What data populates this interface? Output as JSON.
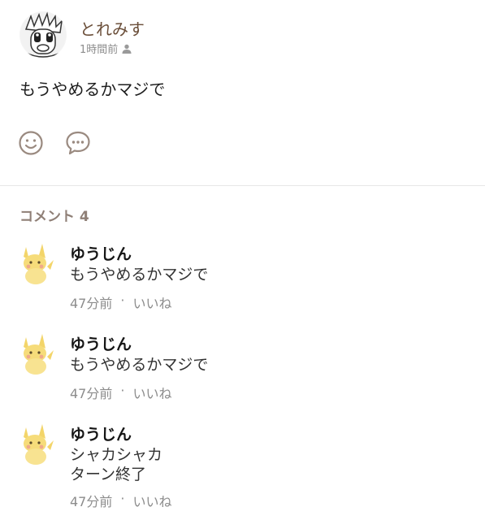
{
  "post": {
    "author": "とれみす",
    "time": "1時間前",
    "body": "もうやめるかマジで"
  },
  "icons": {
    "visibility": "person-icon",
    "reaction": "smiley-icon",
    "comment": "speech-bubble-icon"
  },
  "colors": {
    "author": "#6b4f3a",
    "icon_stroke": "#9a8a80",
    "divider": "#e6e6e6",
    "meta": "#8c8c8c"
  },
  "comments": {
    "heading": "コメント 4",
    "items": [
      {
        "name": "ゆうじん",
        "text": "もうやめるかマジで",
        "time": "47分前",
        "sep": "·",
        "like": "いいね"
      },
      {
        "name": "ゆうじん",
        "text": "もうやめるかマジで",
        "time": "47分前",
        "sep": "·",
        "like": "いいね"
      },
      {
        "name": "ゆうじん",
        "text": "シャカシャカ\nターン終了",
        "time": "47分前",
        "sep": "·",
        "like": "いいね"
      }
    ]
  }
}
